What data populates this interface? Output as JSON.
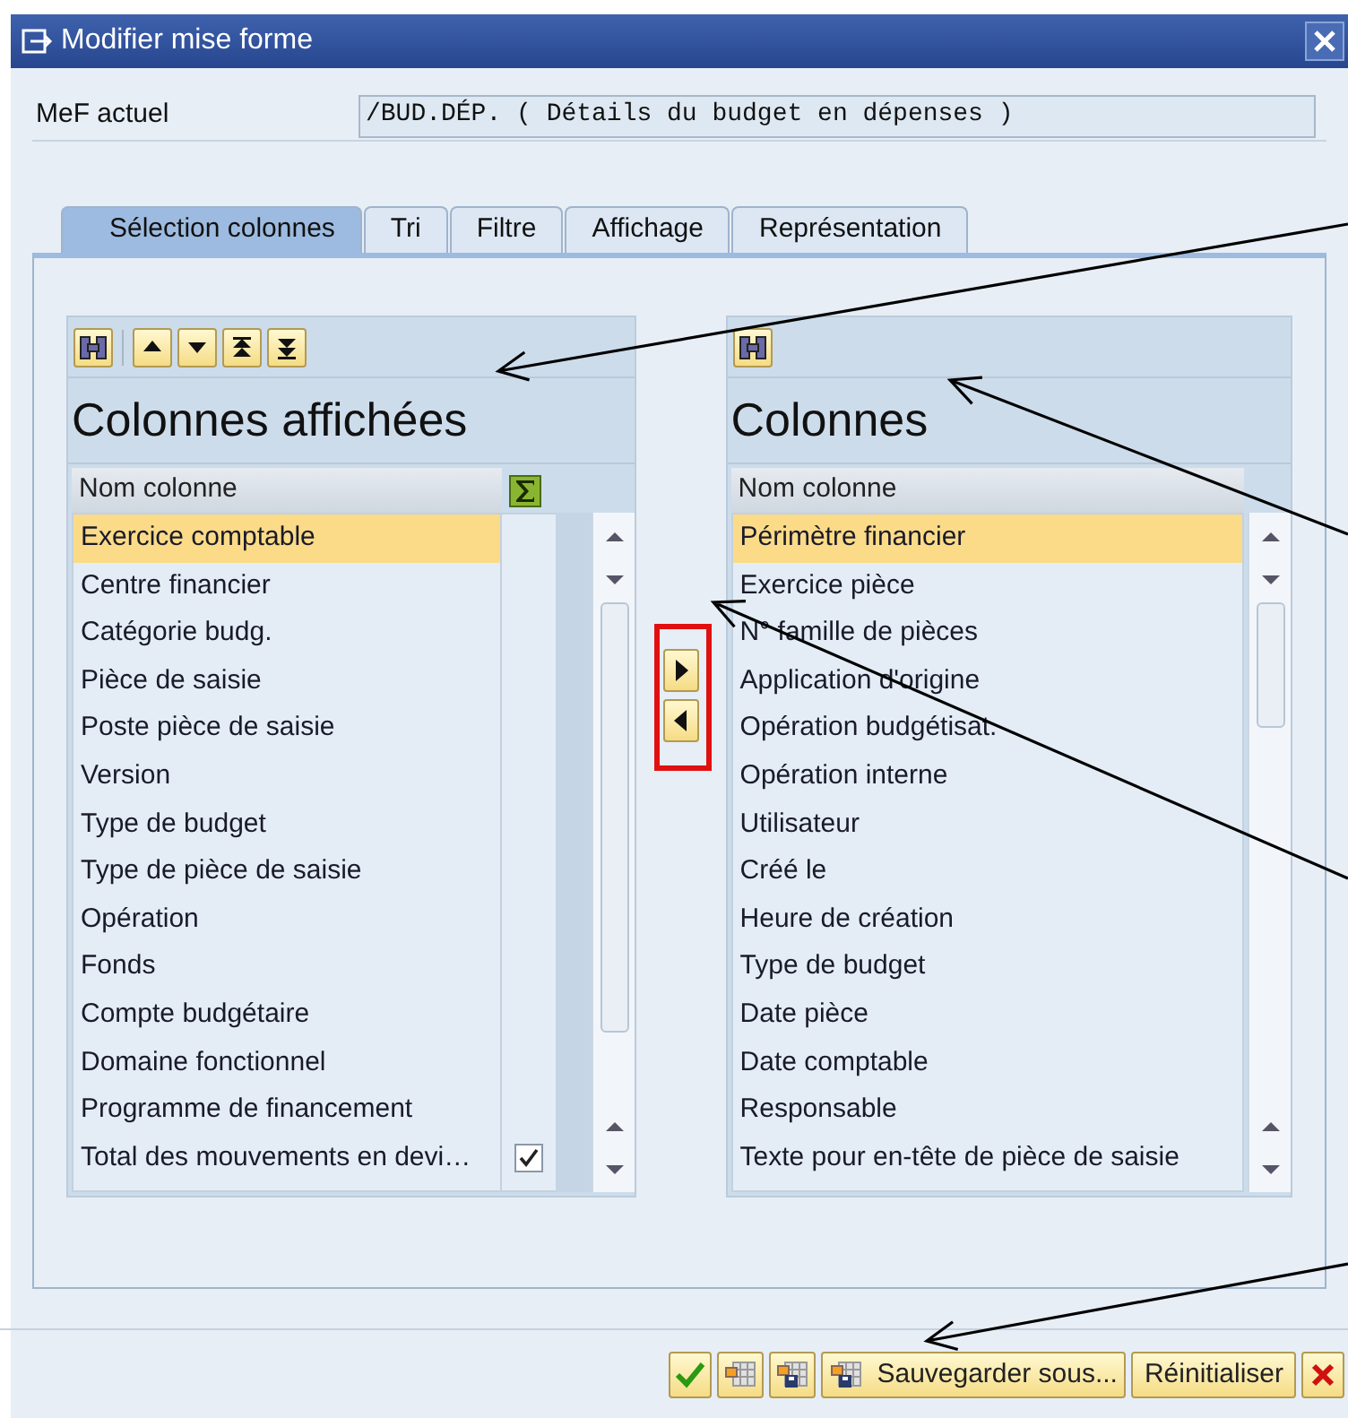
{
  "window": {
    "title": "Modifier mise forme"
  },
  "current_layout": {
    "label": "MeF actuel",
    "value": "/BUD.DÉP. ( Détails du budget en dépenses )"
  },
  "tabs": [
    {
      "label": "Sélection colonnes",
      "selected": true
    },
    {
      "label": "Tri",
      "selected": false
    },
    {
      "label": "Filtre",
      "selected": false
    },
    {
      "label": "Affichage",
      "selected": false
    },
    {
      "label": "Représentation",
      "selected": false
    }
  ],
  "displayed_columns": {
    "title": "Colonnes affichées",
    "header": "Nom colonne",
    "rows": [
      {
        "label": "Exercice comptable",
        "selected": true,
        "summed": false
      },
      {
        "label": "Centre financier",
        "selected": false,
        "summed": false
      },
      {
        "label": "Catégorie budg.",
        "selected": false,
        "summed": false
      },
      {
        "label": "Pièce de saisie",
        "selected": false,
        "summed": false
      },
      {
        "label": "Poste pièce de saisie",
        "selected": false,
        "summed": false
      },
      {
        "label": "Version",
        "selected": false,
        "summed": false
      },
      {
        "label": "Type de budget",
        "selected": false,
        "summed": false
      },
      {
        "label": "Type de pièce de saisie",
        "selected": false,
        "summed": false
      },
      {
        "label": "Opération",
        "selected": false,
        "summed": false
      },
      {
        "label": "Fonds",
        "selected": false,
        "summed": false
      },
      {
        "label": "Compte budgétaire",
        "selected": false,
        "summed": false
      },
      {
        "label": "Domaine fonctionnel",
        "selected": false,
        "summed": false
      },
      {
        "label": "Programme de financement",
        "selected": false,
        "summed": false
      },
      {
        "label": "Total des mouvements en devi…",
        "selected": false,
        "summed": true
      }
    ]
  },
  "available_columns": {
    "title": "Colonnes",
    "header": "Nom colonne",
    "rows": [
      {
        "label": "Périmètre financier",
        "selected": true
      },
      {
        "label": "Exercice pièce",
        "selected": false
      },
      {
        "label": "N° famille de pièces",
        "selected": false
      },
      {
        "label": "Application d'origine",
        "selected": false
      },
      {
        "label": "Opération budgétisat.",
        "selected": false
      },
      {
        "label": "Opération interne",
        "selected": false
      },
      {
        "label": "Utilisateur",
        "selected": false
      },
      {
        "label": "Créé le",
        "selected": false
      },
      {
        "label": "Heure de création",
        "selected": false
      },
      {
        "label": "Type de budget",
        "selected": false
      },
      {
        "label": "Date pièce",
        "selected": false
      },
      {
        "label": "Date comptable",
        "selected": false
      },
      {
        "label": "Responsable",
        "selected": false
      },
      {
        "label": "Texte pour en-tête de pièce de saisie",
        "selected": false
      }
    ]
  },
  "footer_buttons": [
    {
      "kind": "ok"
    },
    {
      "kind": "layout"
    },
    {
      "kind": "save"
    },
    {
      "kind": "save_as",
      "label": "Sauvegarder sous..."
    },
    {
      "kind": "text",
      "label": "Réinitialiser"
    },
    {
      "kind": "cancel"
    }
  ]
}
